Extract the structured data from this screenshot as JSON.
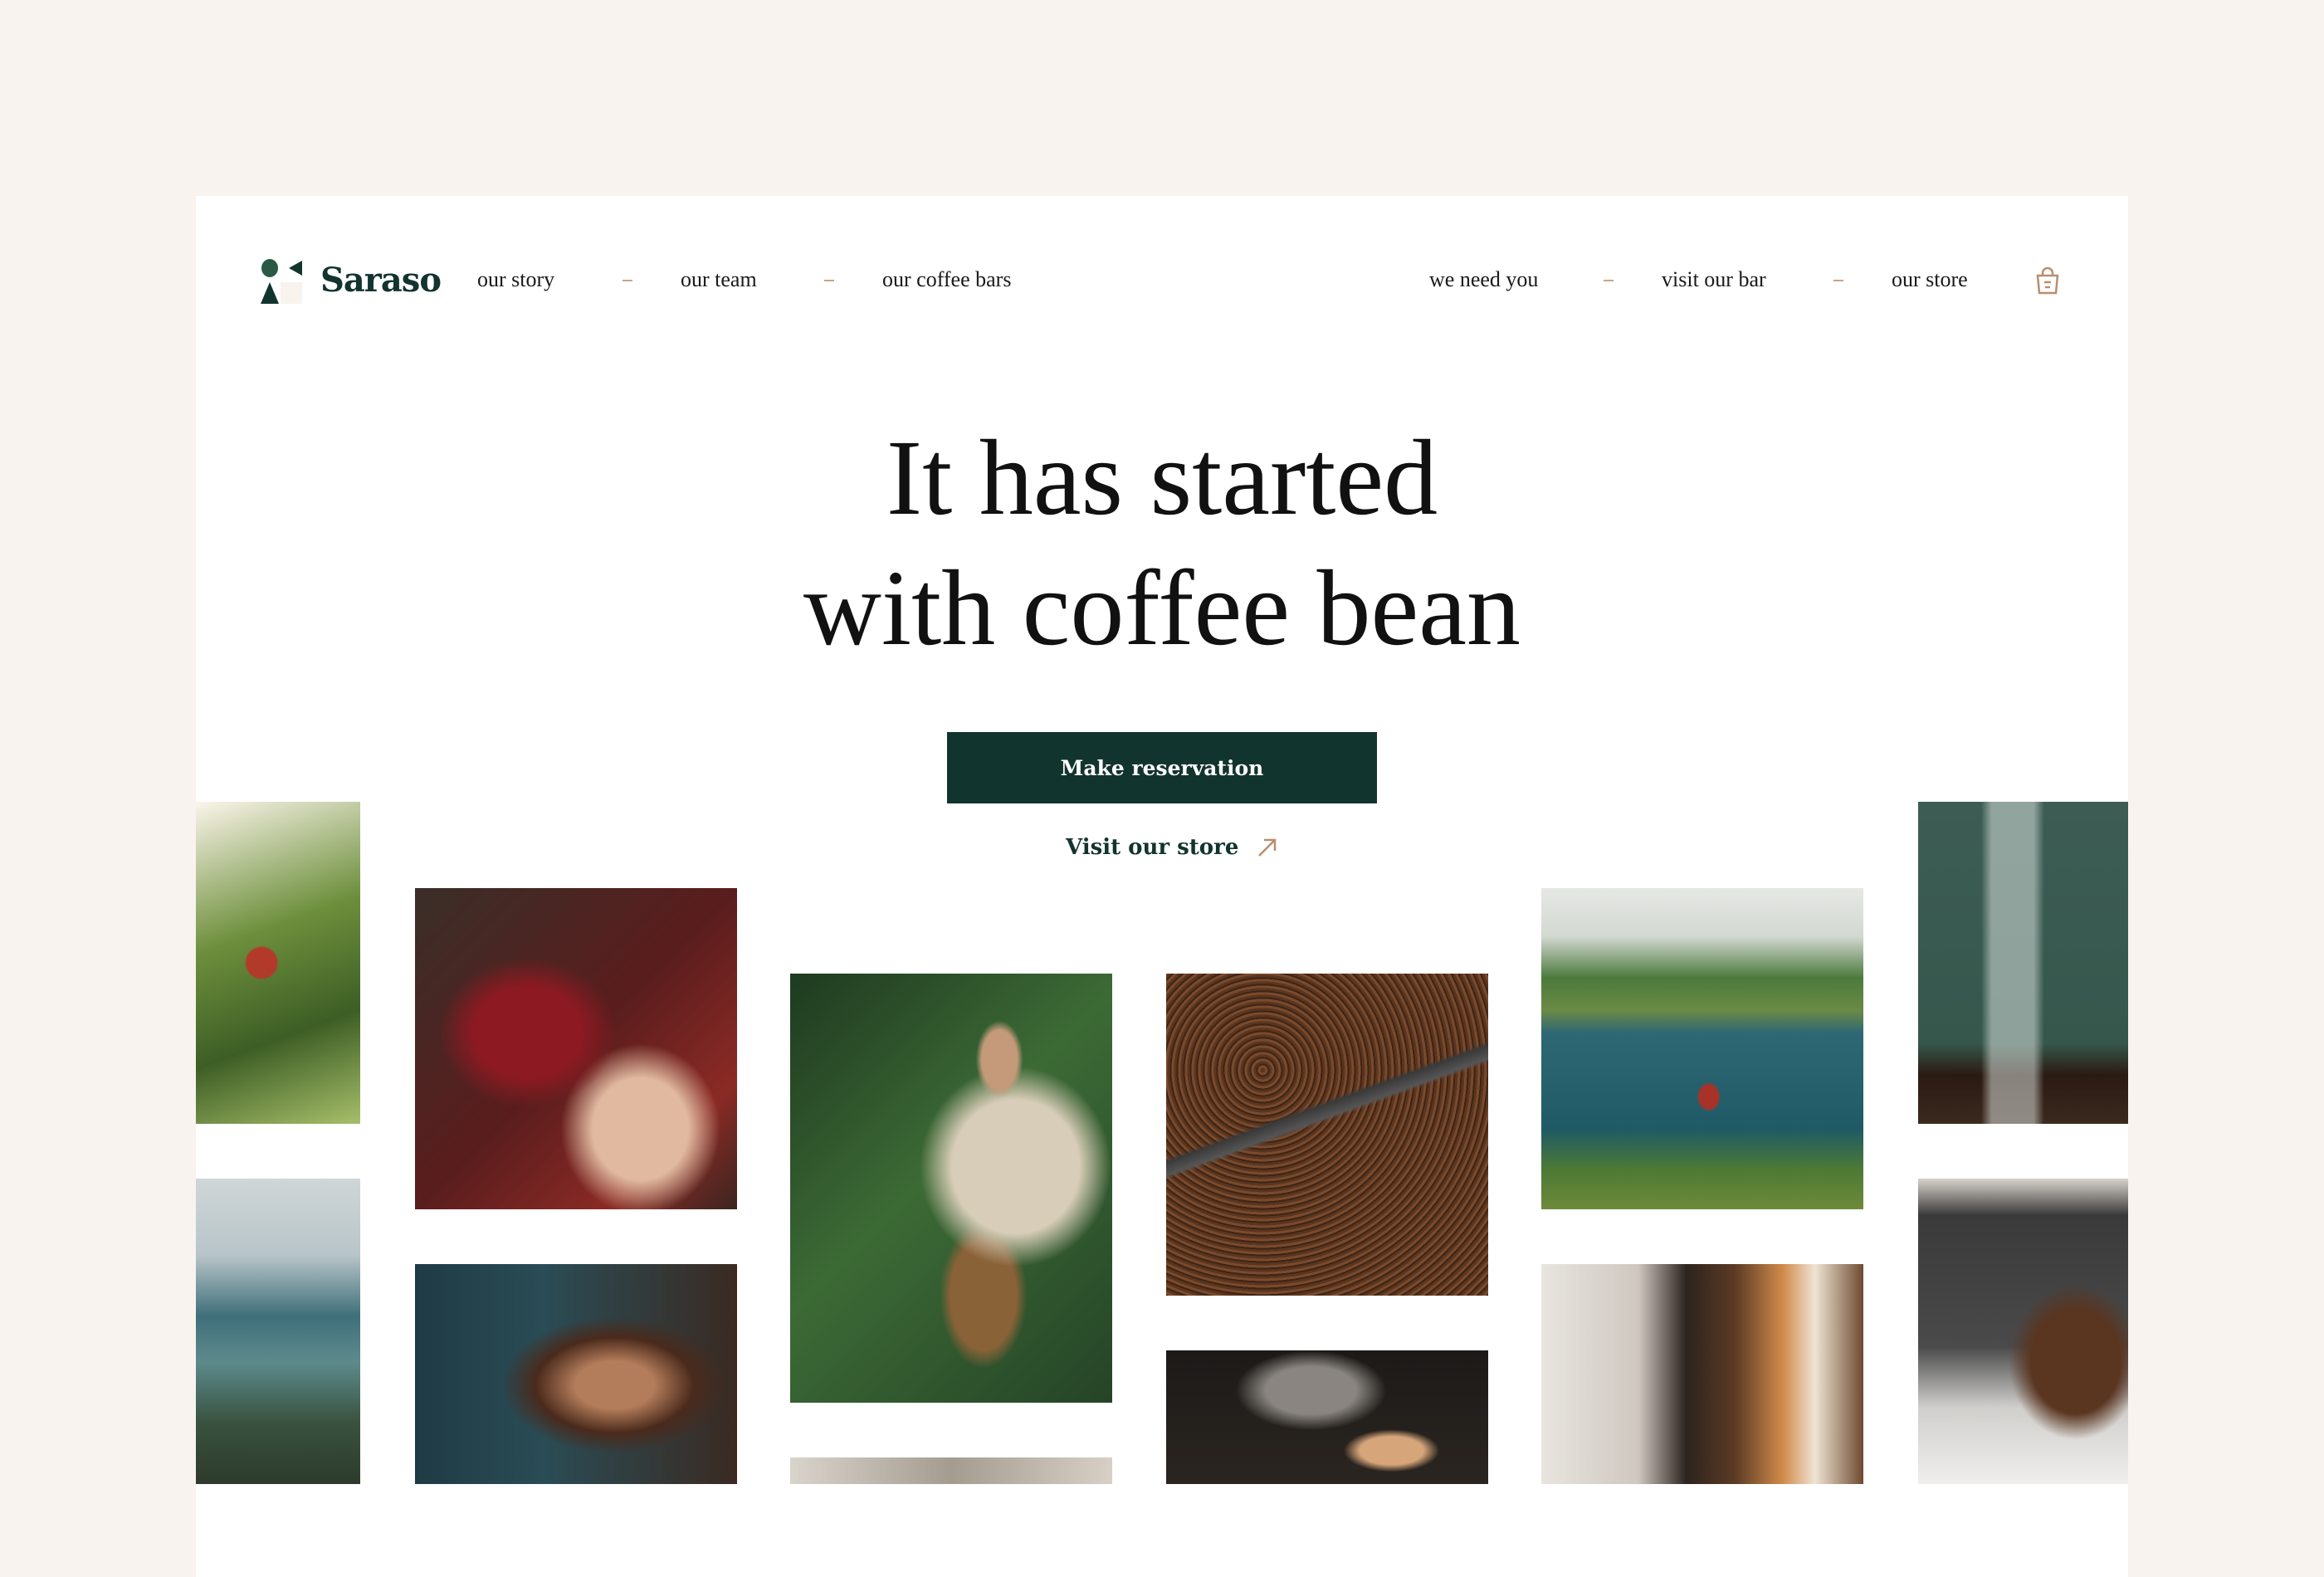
{
  "brand": {
    "name": "Saraso"
  },
  "nav": {
    "left": [
      "our story",
      "our team",
      "our coffee bars"
    ],
    "right": [
      "we need you",
      "visit our bar",
      "our store"
    ],
    "cart_icon": "shopping-bag-icon"
  },
  "hero": {
    "headline_line1": "It has started",
    "headline_line2": "with coffee bean",
    "cta_label": "Make reservation",
    "store_link_label": "Visit our store",
    "store_link_icon": "arrow-up-right-icon"
  },
  "colors": {
    "background": "#f8f3ee",
    "brand_green": "#12342e",
    "accent_tan": "#b98e6e"
  }
}
